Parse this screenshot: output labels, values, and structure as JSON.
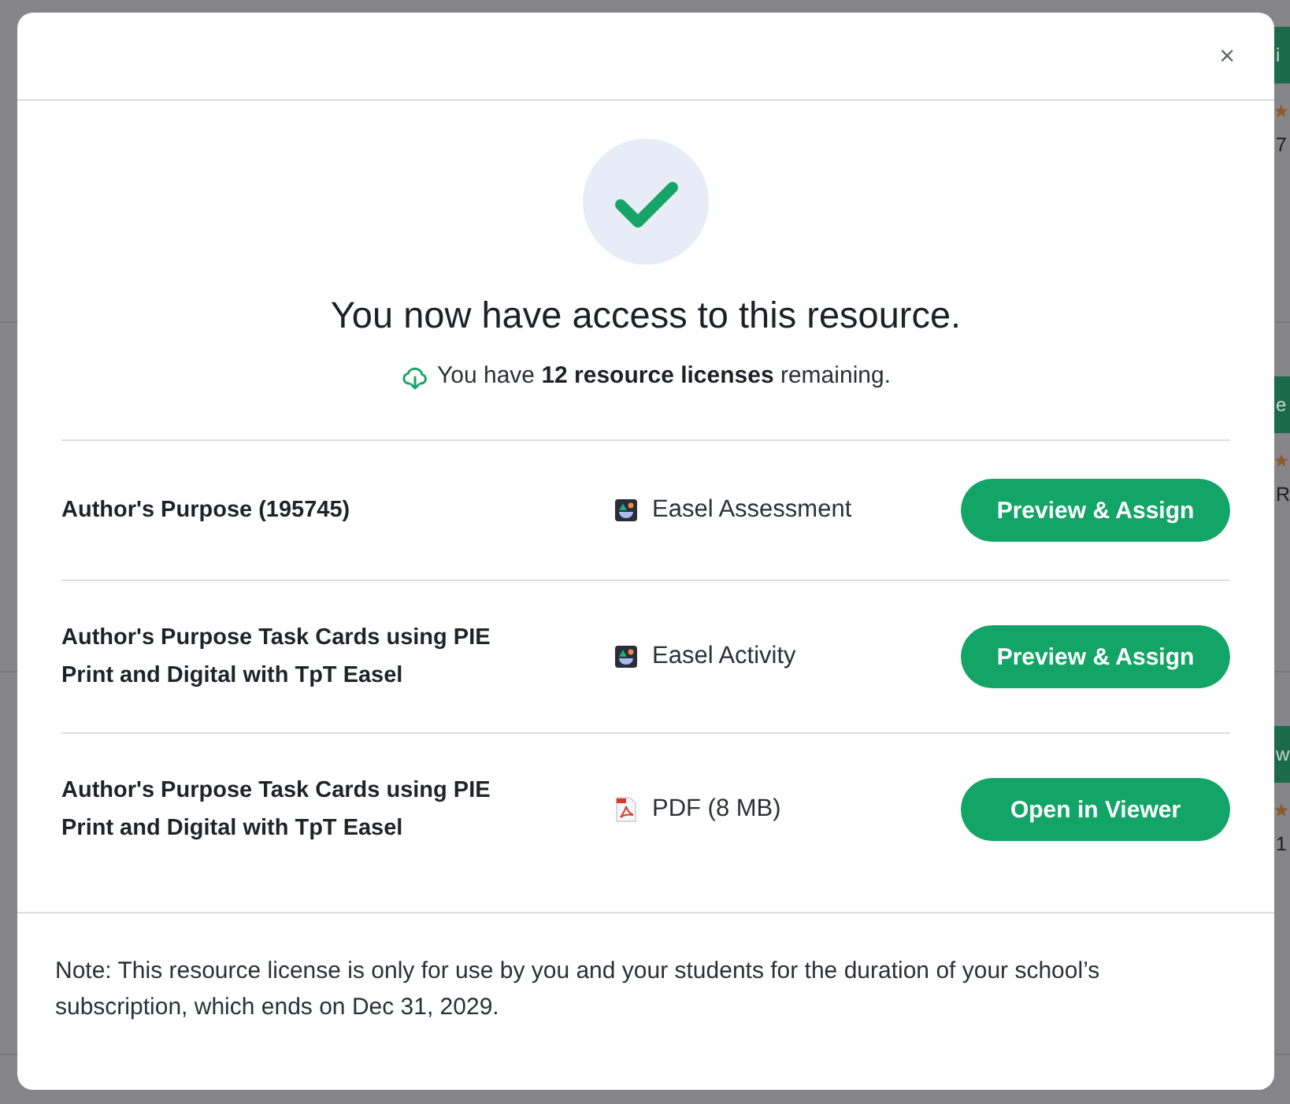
{
  "background": {
    "cards": [
      {
        "button": "i",
        "text": "7"
      },
      {
        "button": "e",
        "text": "R"
      },
      {
        "button": "w",
        "text": "1"
      }
    ]
  },
  "dialog": {
    "close": "×",
    "heading": "You now have access to this resource.",
    "licenses": "You have **12 resource licenses** remaining.",
    "resources": [
      {
        "title": "Author's Purpose (195745)",
        "kind": "easel",
        "type": "Easel Assessment",
        "action": "Preview & Assign"
      },
      {
        "title": "Author's Purpose Task Cards using PIE Print and Digital with TpT Easel",
        "kind": "easel",
        "type": "Easel Activity",
        "action": "Preview & Assign"
      },
      {
        "title": "Author's Purpose Task Cards using PIE Print and Digital with TpT Easel",
        "kind": "pdf",
        "type": "PDF (8 MB)",
        "action": "Open in Viewer"
      }
    ],
    "note": "Note: This resource license is only for use by you and your students for the duration of your school’s subscription, which ends on Dec 31, 2029."
  }
}
